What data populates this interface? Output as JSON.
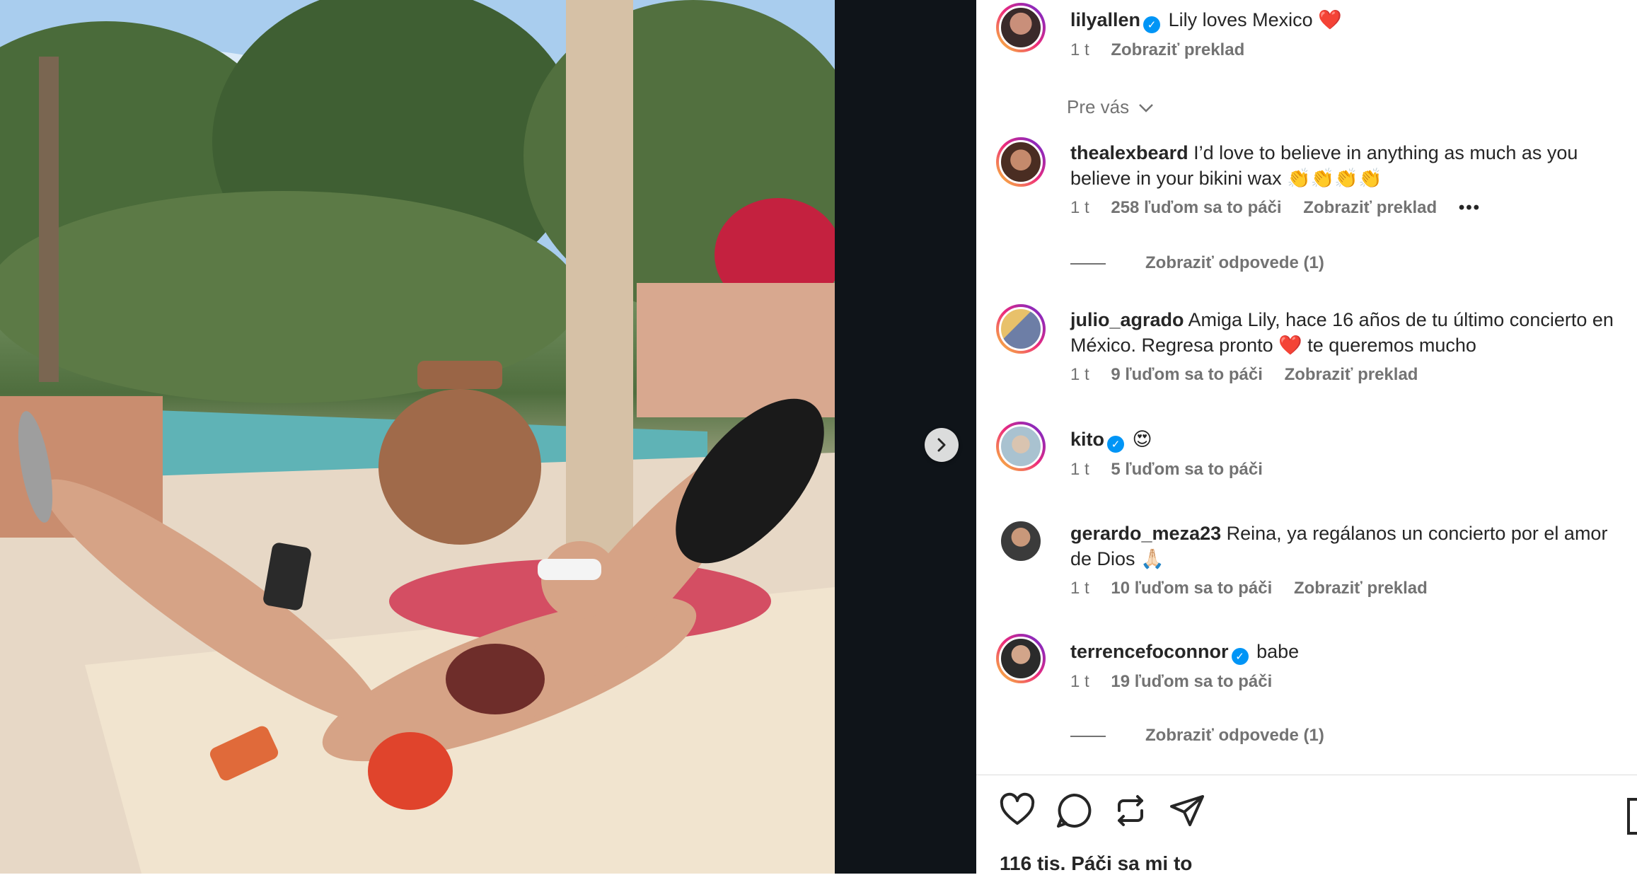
{
  "post": {
    "author": "lilyallen",
    "caption": "Lily loves Mexico",
    "caption_emoji": "❤️",
    "age": "1 t",
    "translate": "Zobraziť preklad"
  },
  "filter_label": "Pre vás",
  "comments": [
    {
      "user": "thealexbeard",
      "verified": false,
      "text": "I’d love to believe in anything as much as you believe in your bikini wax 👏👏👏👏",
      "age": "1 t",
      "likes": "258 ľuďom sa to páči",
      "translate": "Zobraziť preklad",
      "more": "•••"
    },
    {
      "user": "julio_agrado",
      "verified": false,
      "text": "Amiga Lily, hace 16 años de tu último concierto en México. Regresa pronto ❤️ te queremos mucho",
      "age": "1 t",
      "likes": "9 ľuďom sa to páči",
      "translate": "Zobraziť preklad"
    },
    {
      "user": "kito",
      "verified": true,
      "text": "😍",
      "age": "1 t",
      "likes": "5 ľuďom sa to páči"
    },
    {
      "user": "gerardo_meza23",
      "verified": false,
      "text": "Reina, ya regálanos un concierto por el amor de Dios 🙏🏻",
      "age": "1 t",
      "likes": "10 ľuďom sa to páči",
      "translate": "Zobraziť preklad"
    },
    {
      "user": "terrencefoconnor",
      "verified": true,
      "text": "babe",
      "age": "1 t",
      "likes": "19 ľuďom sa to páči"
    }
  ],
  "view_replies": [
    "Zobraziť odpovede (1)",
    "Zobraziť odpovede (1)"
  ],
  "likes_count": "116 tis.",
  "likes_suffix": "Páči sa mi to",
  "colors": {
    "link": "#0095f6",
    "muted": "#737373",
    "gutter": "#0f1419"
  },
  "icons": [
    "heart-icon",
    "comment-icon",
    "repost-icon",
    "share-icon",
    "bookmark-icon",
    "chevron-right-icon",
    "chevron-down-icon",
    "verified-icon"
  ]
}
